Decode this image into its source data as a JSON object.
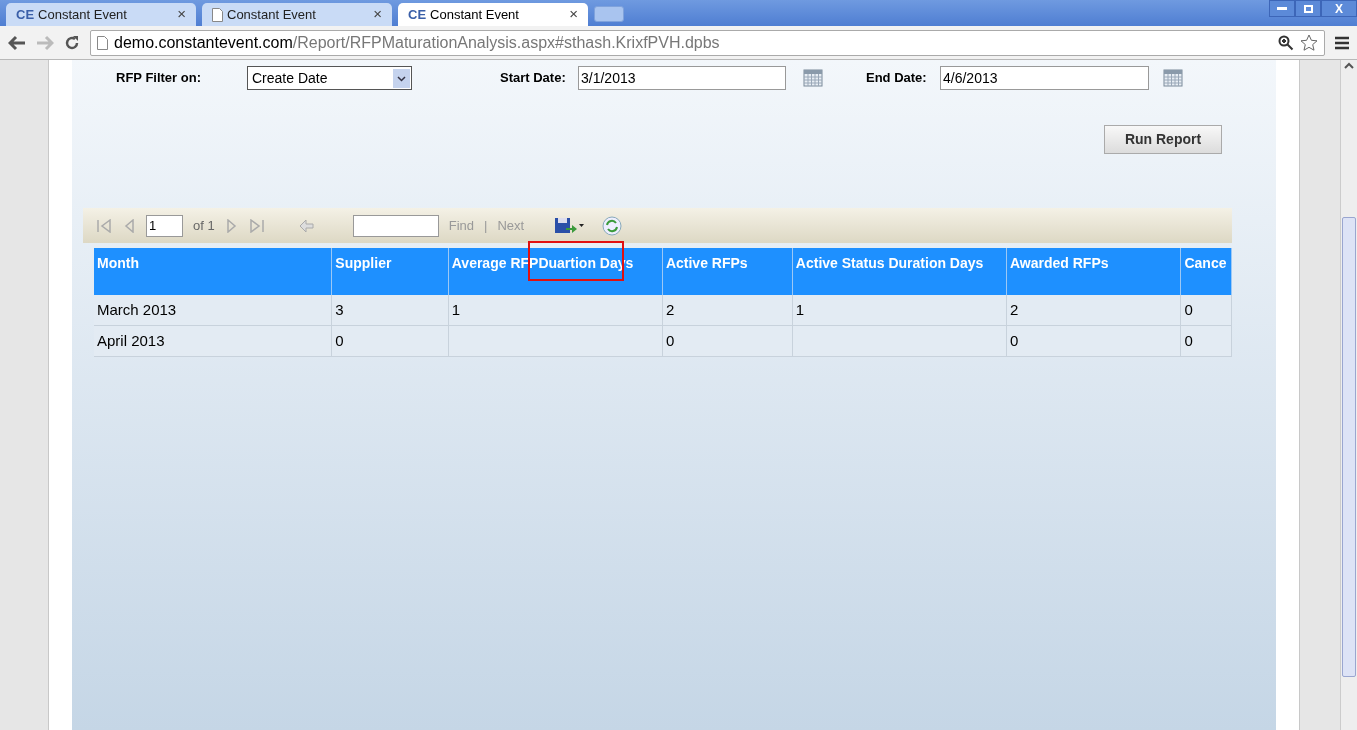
{
  "tabs": [
    {
      "title": "Constant Event",
      "kind": "logo",
      "icon_text": "CE",
      "close": "×",
      "selected": false
    },
    {
      "title": "Constant Event",
      "kind": "page",
      "close": "×",
      "selected": false
    },
    {
      "title": "Constant Event",
      "kind": "logo",
      "icon_text": "CE",
      "close": "×",
      "selected": true
    }
  ],
  "window_controls": {
    "close": "X"
  },
  "address": {
    "host": "demo.constantevent.com",
    "path": "/Report/RFPMaturationAnalysis.aspx#sthash.KrixfPVH.dpbs"
  },
  "filters": {
    "filter_label": "RFP Filter on:",
    "filter_value": "Create Date",
    "start_label": "Start Date:",
    "start_value": "3/1/2013",
    "end_label": "End Date:",
    "end_value": "4/6/2013",
    "run_button": "Run Report"
  },
  "report_toolbar": {
    "page_value": "1",
    "page_of": "of 1",
    "find": "Find",
    "separator": "|",
    "next": "Next"
  },
  "table": {
    "columns": [
      "Month",
      "Supplier",
      "Average RFPDuartion Days",
      "Active RFPs",
      "Active Status Duration Days",
      "Awarded RFPs",
      "Cance"
    ],
    "rows": [
      [
        "March 2013",
        "3",
        "1",
        "2",
        "1",
        "2",
        "0"
      ],
      [
        "April 2013",
        "0",
        "",
        "0",
        "",
        "0",
        "0"
      ]
    ]
  }
}
